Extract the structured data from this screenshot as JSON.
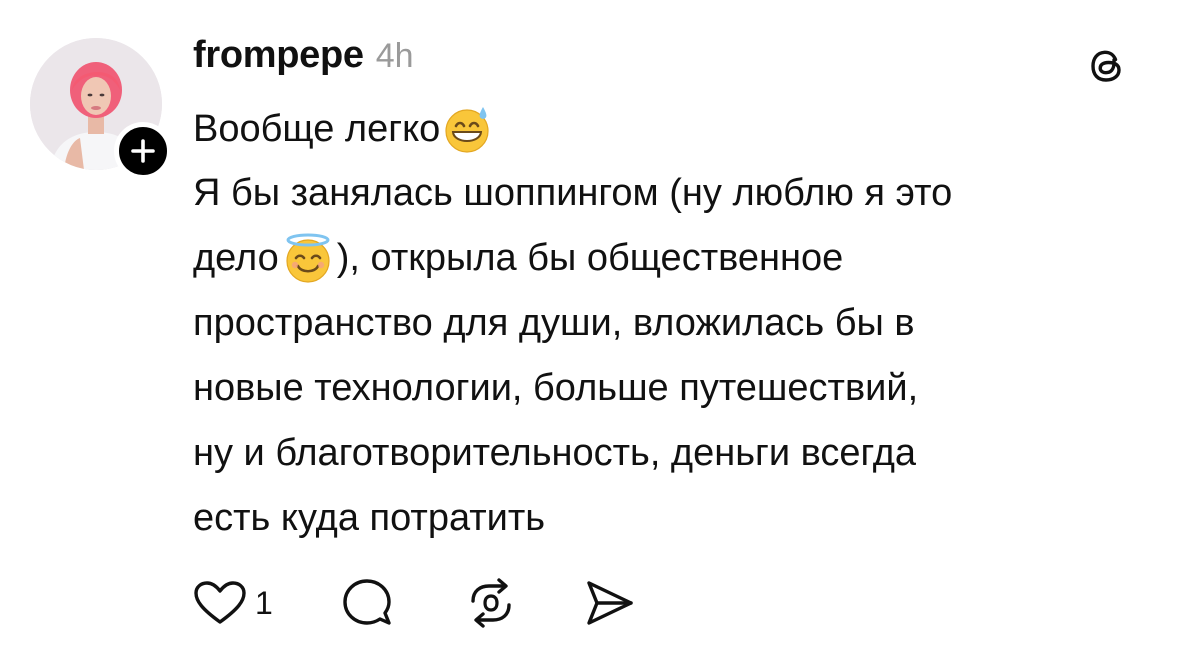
{
  "post": {
    "username": "frompepe",
    "timestamp": "4h",
    "first_line_text": "Вообще легко",
    "first_line_emoji": "grinning-sweat-emoji",
    "body_lines": [
      "Я бы занялась шоппингом (ну люблю я это",
      "дело",
      "), открыла бы общественное",
      "пространство для души, вложилась бы в",
      "новые технологии, больше путешествий,",
      "ну и благотворительность, деньги всегда",
      "есть куда потратить"
    ],
    "inline_emoji": "smiling-halo-emoji"
  },
  "avatar": {
    "icon": "user-avatar",
    "follow_icon": "plus-icon"
  },
  "header_icon": "threads-logo-icon",
  "actions": {
    "like_icon": "heart-icon",
    "like_count": "1",
    "comment_icon": "comment-bubble-icon",
    "repost_icon": "repost-icon",
    "share_icon": "send-icon"
  },
  "colors": {
    "text": "#111111",
    "muted": "#9a9a9a",
    "hair": "#f26a7a",
    "background": "#ffffff"
  }
}
